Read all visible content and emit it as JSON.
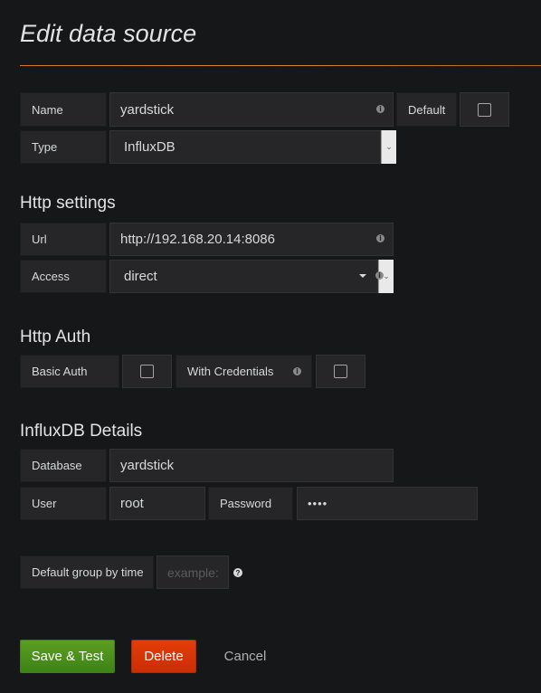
{
  "page": {
    "title": "Edit data source"
  },
  "general": {
    "name_label": "Name",
    "name_value": "yardstick",
    "default_label": "Default",
    "default_checked": false,
    "type_label": "Type",
    "type_value": "InfluxDB"
  },
  "http": {
    "heading": "Http settings",
    "url_label": "Url",
    "url_value": "http://192.168.20.14:8086",
    "access_label": "Access",
    "access_value": "direct"
  },
  "auth": {
    "heading": "Http Auth",
    "basic_auth_label": "Basic Auth",
    "basic_auth_checked": false,
    "with_credentials_label": "With Credentials",
    "with_credentials_checked": false
  },
  "influx": {
    "heading": "InfluxDB Details",
    "database_label": "Database",
    "database_value": "yardstick",
    "user_label": "User",
    "user_value": "root",
    "password_label": "Password",
    "password_value": "••••"
  },
  "grouping": {
    "label": "Default group by time",
    "placeholder": "example:"
  },
  "actions": {
    "save_label": "Save & Test",
    "delete_label": "Delete",
    "cancel_label": "Cancel"
  },
  "icons": {
    "info": "info-icon",
    "help": "question-circle-icon",
    "caret": "caret-down-icon",
    "select_chevron": "chevron-down-icon"
  },
  "colors": {
    "accent_rule": "#d9892e",
    "save": "#4d9a1d",
    "delete": "#e03a07",
    "background": "#161719",
    "field": "#262628"
  }
}
